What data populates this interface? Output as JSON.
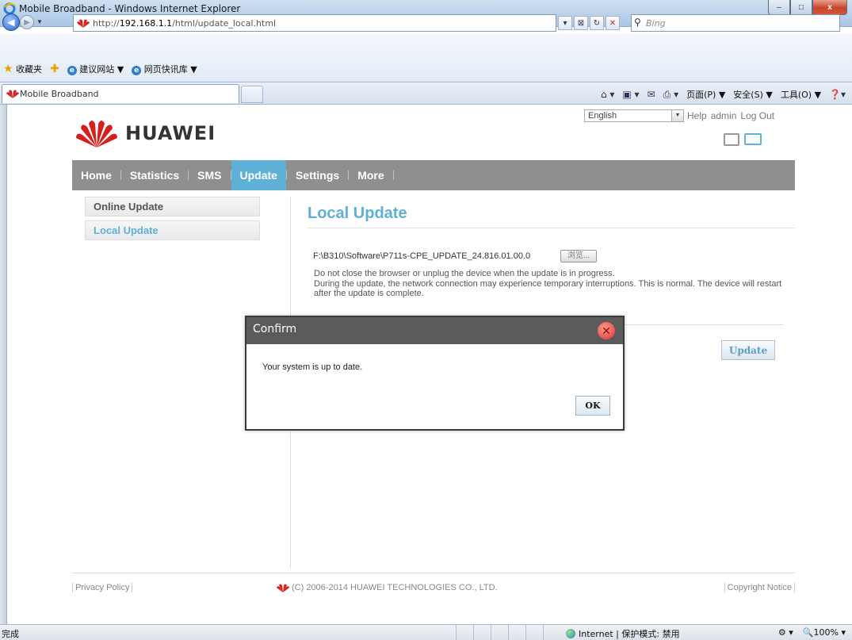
{
  "window": {
    "title": "Mobile Broadband - Windows Internet Explorer",
    "buttons": [
      "–",
      "□",
      "x"
    ]
  },
  "browser": {
    "url_prefix": "http://",
    "url_host": "192.168.1.1",
    "url_path": "/html/update_local.html",
    "search_placeholder": "Bing",
    "favorites_label": "收藏夹",
    "favorites_links": [
      "建议网站 ▼",
      "网页快讯库 ▼"
    ],
    "tab_title": "Mobile Broadband",
    "commands": [
      "页面(P) ▼",
      "安全(S) ▼",
      "工具(O) ▼"
    ]
  },
  "header": {
    "brand": "HUAWEI",
    "language": "English",
    "links": [
      "Help",
      "admin",
      "Log Out"
    ]
  },
  "nav": {
    "items": [
      "Home",
      "Statistics",
      "SMS",
      "Update",
      "Settings",
      "More"
    ],
    "active": "Update"
  },
  "sidebar": {
    "items": [
      "Online Update",
      "Local Update"
    ],
    "active": "Local Update"
  },
  "main": {
    "title": "Local Update",
    "file_path": "F:\\B310\\Software\\P711s-CPE_UPDATE_24.816.01.00.0",
    "browse_label": "浏览...",
    "notes": [
      "Do not close the browser or unplug the device when the update is in progress.",
      "During the update, the network connection may experience temporary interruptions. This is normal. The device will restart after the update is complete."
    ],
    "update_button": "Update"
  },
  "footer": {
    "privacy": "Privacy Policy",
    "copyright": "(C) 2006-2014 HUAWEI TECHNOLOGIES CO., LTD.",
    "notice": "Copyright Notice"
  },
  "modal": {
    "title": "Confirm",
    "message": "Your system is up to date.",
    "ok_label": "OK"
  },
  "statusbar": {
    "status": "完成",
    "zone": "Internet | 保护模式: 禁用",
    "zoom": "100%"
  },
  "colors": {
    "accent": "#5fb0d6",
    "nav_bg": "#8f8f8f",
    "modal_header": "#5b5b5b"
  }
}
